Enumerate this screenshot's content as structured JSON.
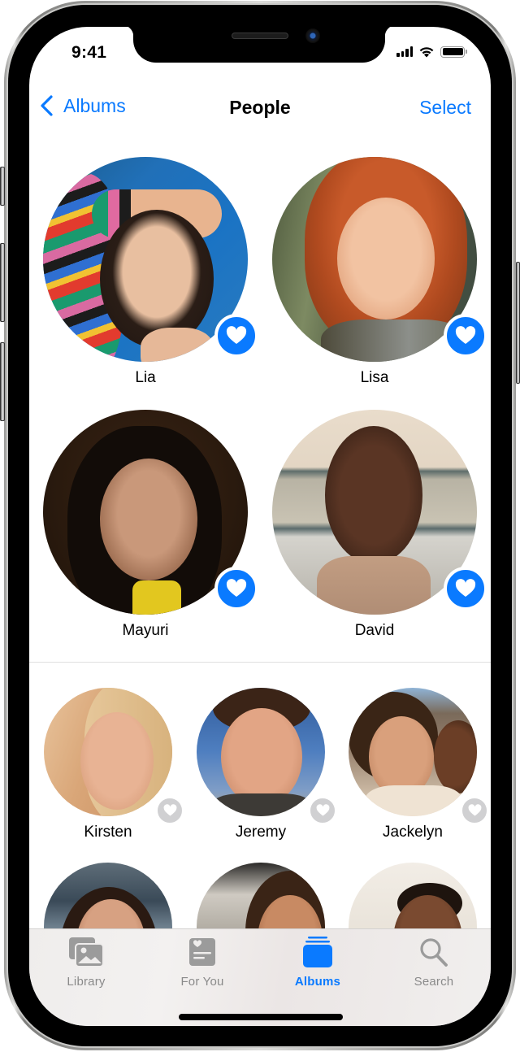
{
  "status_bar": {
    "time": "9:41",
    "icons": [
      "cellular-signal-icon",
      "wifi-icon",
      "battery-icon"
    ]
  },
  "nav": {
    "back_label": "Albums",
    "title": "People",
    "select_label": "Select"
  },
  "favorites": [
    {
      "name": "Lia",
      "favorite": true
    },
    {
      "name": "Lisa",
      "favorite": true
    },
    {
      "name": "Mayuri",
      "favorite": true
    },
    {
      "name": "David",
      "favorite": true
    }
  ],
  "people": [
    {
      "name": "Kirsten",
      "favorite": false
    },
    {
      "name": "Jeremy",
      "favorite": false
    },
    {
      "name": "Jackelyn",
      "favorite": false
    },
    {
      "name": "",
      "favorite": false
    },
    {
      "name": "",
      "favorite": false
    },
    {
      "name": "",
      "favorite": false
    }
  ],
  "tab_bar": {
    "tabs": [
      {
        "label": "Library",
        "icon": "photo-library-icon",
        "active": false
      },
      {
        "label": "For You",
        "icon": "for-you-icon",
        "active": false
      },
      {
        "label": "Albums",
        "icon": "albums-icon",
        "active": true
      },
      {
        "label": "Search",
        "icon": "search-icon",
        "active": false
      }
    ]
  },
  "colors": {
    "accent": "#0a7aff",
    "favorite_badge_on": "#0a7aff",
    "favorite_badge_off": "#d0d0d2",
    "tab_inactive": "#8a8a8a"
  }
}
